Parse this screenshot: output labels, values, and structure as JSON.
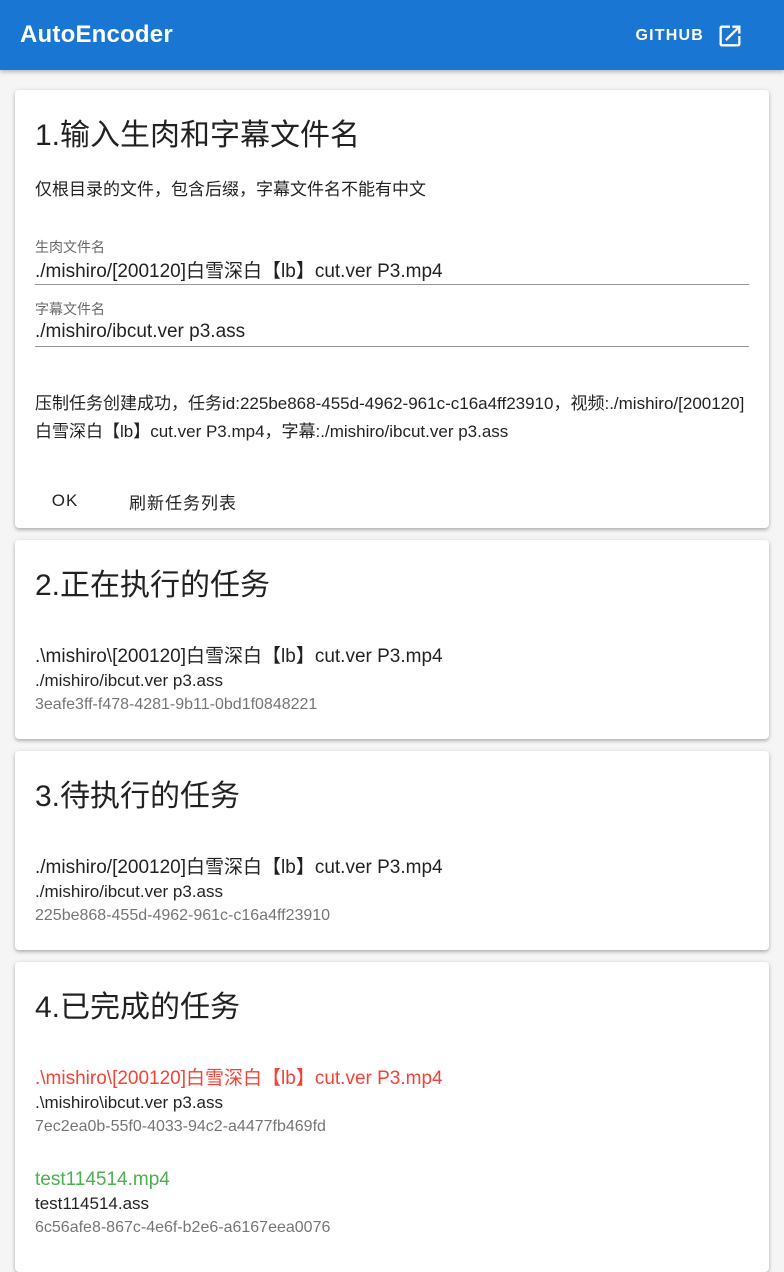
{
  "app": {
    "title": "AutoEncoder",
    "github_label": "GITHUB",
    "github_icon": "open-in-new-icon",
    "primary_color": "#1976d2"
  },
  "input_section": {
    "title": "1.输入生肉和字幕文件名",
    "description": "仅根目录的文件，包含后缀，字幕文件名不能有中文",
    "video_field": {
      "label": "生肉文件名",
      "value": "./mishiro/[200120]白雪深白【lb】cut.ver P3.mp4"
    },
    "subtitle_field": {
      "label": "字幕文件名",
      "value": "./mishiro/ibcut.ver p3.ass"
    },
    "message": "压制任务创建成功，任务id:225be868-455d-4962-961c-c16a4ff23910，视频:./mishiro/[200120]白雪深白【lb】cut.ver P3.mp4，字幕:./mishiro/ibcut.ver p3.ass",
    "ok_label": "OK",
    "refresh_label": "刷新任务列表"
  },
  "running_section": {
    "title": "2.正在执行的任务",
    "tasks": [
      {
        "video": ".\\mishiro\\[200120]白雪深白【lb】cut.ver P3.mp4",
        "subtitle": "./mishiro/ibcut.ver p3.ass",
        "id": "3eafe3ff-f478-4281-9b11-0bd1f0848221"
      }
    ]
  },
  "pending_section": {
    "title": "3.待执行的任务",
    "tasks": [
      {
        "video": "./mishiro/[200120]白雪深白【lb】cut.ver P3.mp4",
        "subtitle": "./mishiro/ibcut.ver p3.ass",
        "id": "225be868-455d-4962-961c-c16a4ff23910"
      }
    ]
  },
  "finished_section": {
    "title": "4.已完成的任务",
    "failed_color": "#f44336",
    "success_color": "#4caf50",
    "tasks": [
      {
        "video": ".\\mishiro\\[200120]白雪深白【lb】cut.ver P3.mp4",
        "subtitle": ".\\mishiro\\ibcut.ver p3.ass",
        "id": "7ec2ea0b-55f0-4033-94c2-a4477fb469fd",
        "status": "failed"
      },
      {
        "video": "test114514.mp4",
        "subtitle": "test114514.ass",
        "id": "6c56afe8-867c-4e6f-b2e6-a6167eea0076",
        "status": "success"
      }
    ]
  }
}
